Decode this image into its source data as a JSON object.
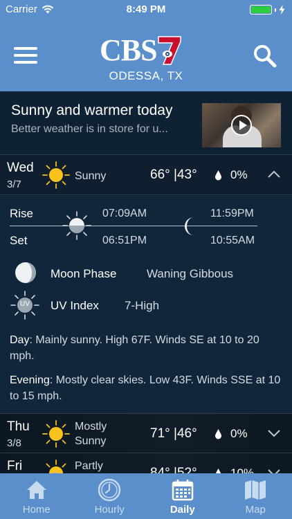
{
  "status": {
    "carrier": "Carrier",
    "time": "8:49 PM"
  },
  "header": {
    "logo_text": "CBS",
    "logo_number": "7",
    "city": "ODESSA, TX"
  },
  "news": {
    "title": "Sunny and warmer today",
    "subtitle": "Better weather is in store for u..."
  },
  "days": [
    {
      "name": "Wed",
      "date": "3/7",
      "icon": "sun-icon",
      "condition": "Sunny",
      "temps": "66° |43°",
      "precip": "0%"
    },
    {
      "name": "Thu",
      "date": "3/8",
      "icon": "sun-icon",
      "condition_line1": "Mostly",
      "condition_line2": "Sunny",
      "temps": "71° |46°",
      "precip": "0%"
    },
    {
      "name": "Fri",
      "icon": "partly-cloudy-icon",
      "condition_line1": "Partly",
      "temps": "84° |52°",
      "precip": "10%"
    }
  ],
  "detail": {
    "rise_label": "Rise",
    "set_label": "Set",
    "sunrise": "07:09AM",
    "sunset": "06:51PM",
    "moonrise": "11:59PM",
    "moonset": "10:55AM",
    "moon_phase_label": "Moon Phase",
    "moon_phase_value": "Waning Gibbous",
    "uv_label": "UV Index",
    "uv_value": "7-High",
    "uv_icon_text": "UV",
    "day_label": "Day",
    "day_text": ": Mainly sunny. High 67F. Winds SE at 10 to 20 mph.",
    "evening_label": "Evening",
    "evening_text": ": Mostly clear skies. Low 43F. Winds SSE at 10 to 15 mph."
  },
  "nav": {
    "items": [
      {
        "label": "Home",
        "icon": "home-icon"
      },
      {
        "label": "Hourly",
        "icon": "clock-icon"
      },
      {
        "label": "Daily",
        "icon": "calendar-icon"
      },
      {
        "label": "Map",
        "icon": "map-icon"
      }
    ],
    "active": "Daily"
  },
  "colors": {
    "header": "#5b8fcb",
    "background": "#0f1f2f",
    "sun": "#f6c21b",
    "accent_red": "#c8102e"
  }
}
